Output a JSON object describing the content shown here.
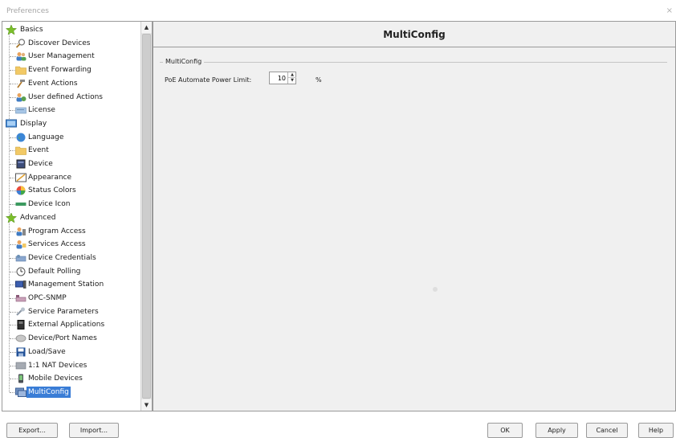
{
  "window": {
    "title": "Preferences",
    "close_glyph": "×"
  },
  "tree": {
    "items": [
      {
        "label": "Basics",
        "icon": "star-icon",
        "level": 0
      },
      {
        "label": "Discover Devices",
        "icon": "magnifier-icon",
        "level": 1
      },
      {
        "label": "User Management",
        "icon": "users-icon",
        "level": 1
      },
      {
        "label": "Event Forwarding",
        "icon": "event-folder-icon",
        "level": 1
      },
      {
        "label": "Event Actions",
        "icon": "hammer-icon",
        "level": 1
      },
      {
        "label": "User defined Actions",
        "icon": "user-actions-icon",
        "level": 1
      },
      {
        "label": "License",
        "icon": "license-icon",
        "level": 1
      },
      {
        "label": "Display",
        "icon": "display-icon",
        "level": 0
      },
      {
        "label": "Language",
        "icon": "globe-icon",
        "level": 1
      },
      {
        "label": "Event",
        "icon": "event-folder-icon",
        "level": 1
      },
      {
        "label": "Device",
        "icon": "device-icon",
        "level": 1
      },
      {
        "label": "Appearance",
        "icon": "appearance-icon",
        "level": 1
      },
      {
        "label": "Status Colors",
        "icon": "color-wheel-icon",
        "level": 1
      },
      {
        "label": "Device Icon",
        "icon": "device-icon-icon",
        "level": 1
      },
      {
        "label": "Advanced",
        "icon": "star-icon",
        "level": 0
      },
      {
        "label": "Program Access",
        "icon": "program-access-icon",
        "level": 1
      },
      {
        "label": "Services Access",
        "icon": "services-access-icon",
        "level": 1
      },
      {
        "label": "Device Credentials",
        "icon": "credentials-icon",
        "level": 1
      },
      {
        "label": "Default Polling",
        "icon": "clock-icon",
        "level": 1
      },
      {
        "label": "Management Station",
        "icon": "station-icon",
        "level": 1
      },
      {
        "label": "OPC-SNMP",
        "icon": "opc-icon",
        "level": 1
      },
      {
        "label": "Service Parameters",
        "icon": "wrench-icon",
        "level": 1
      },
      {
        "label": "External Applications",
        "icon": "external-apps-icon",
        "level": 1
      },
      {
        "label": "Device/Port Names",
        "icon": "port-names-icon",
        "level": 1
      },
      {
        "label": "Load/Save",
        "icon": "floppy-icon",
        "level": 1
      },
      {
        "label": "1:1 NAT Devices",
        "icon": "nat-icon",
        "level": 1
      },
      {
        "label": "Mobile Devices",
        "icon": "mobile-icon",
        "level": 1
      },
      {
        "label": "MultiConfig",
        "icon": "multiconfig-icon",
        "level": 1,
        "selected": true
      }
    ]
  },
  "content": {
    "title": "MultiConfig",
    "group_title": "MultiConfig",
    "poe_label": "PoE Automate Power Limit:",
    "poe_value": "10",
    "poe_unit": "%"
  },
  "buttons": {
    "export": "Export...",
    "import": "Import...",
    "ok": "OK",
    "apply": "Apply",
    "cancel": "Cancel",
    "help": "Help"
  },
  "colors": {
    "selection": "#3a7dd6",
    "panel_bg": "#f0f0f0",
    "star": "#7bbf2a"
  }
}
